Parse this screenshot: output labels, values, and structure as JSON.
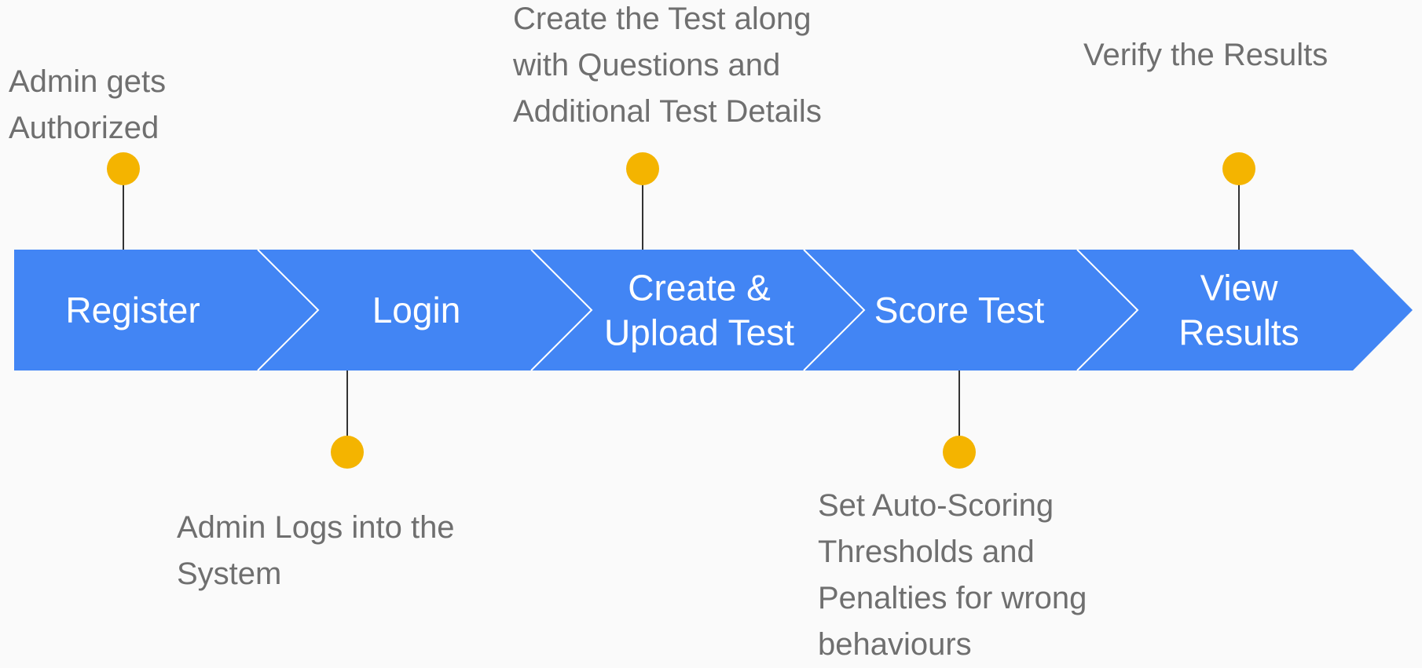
{
  "colors": {
    "background": "#fafafa",
    "arrow_fill": "#4285f4",
    "arrow_divider": "#ffffff",
    "stage_text": "#ffffff",
    "marker": "#f4b400",
    "connector": "#333333",
    "note_text": "#6f6f6f"
  },
  "stages": [
    {
      "label_lines": [
        "Register"
      ],
      "note_lines": [
        "Admin gets",
        "Authorized"
      ],
      "note_position": "above"
    },
    {
      "label_lines": [
        "Login"
      ],
      "note_lines": [
        "Admin Logs into the",
        "System"
      ],
      "note_position": "below"
    },
    {
      "label_lines": [
        "Create &",
        "Upload Test"
      ],
      "note_lines": [
        "Create the Test along",
        "with Questions and",
        "Additional Test Details"
      ],
      "note_position": "above"
    },
    {
      "label_lines": [
        "Score Test"
      ],
      "note_lines": [
        "Set Auto-Scoring",
        "Thresholds and",
        "Penalties for wrong",
        "behaviours"
      ],
      "note_position": "below"
    },
    {
      "label_lines": [
        "View",
        "Results"
      ],
      "note_lines": [
        "Verify the Results"
      ],
      "note_position": "above"
    }
  ]
}
